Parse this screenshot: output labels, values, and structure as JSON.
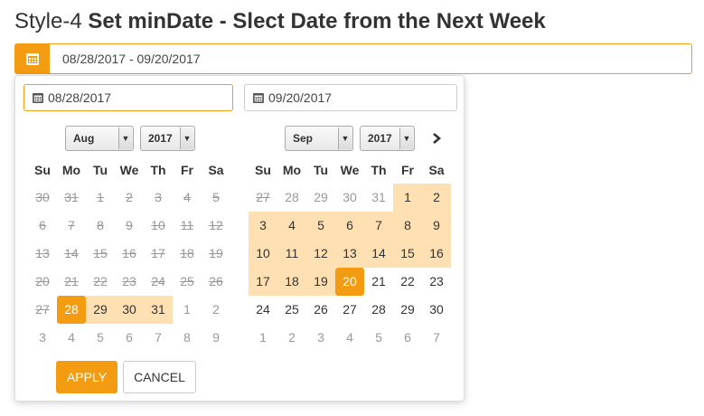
{
  "heading": {
    "prefix": "Style-4 ",
    "bold": "Set minDate - Slect Date from the Next Week"
  },
  "range_field": {
    "icon": "calendar-icon",
    "value": "08/28/2017 - 09/20/2017"
  },
  "start_input": {
    "value": "08/28/2017",
    "icon": "calendar-icon"
  },
  "end_input": {
    "value": "09/20/2017",
    "icon": "calendar-icon"
  },
  "left_calendar": {
    "month": "Aug",
    "year": "2017",
    "weekdays": [
      "Su",
      "Mo",
      "Tu",
      "We",
      "Th",
      "Fr",
      "Sa"
    ],
    "days": [
      {
        "d": "30",
        "s": "dis"
      },
      {
        "d": "31",
        "s": "dis"
      },
      {
        "d": "1",
        "s": "dis"
      },
      {
        "d": "2",
        "s": "dis"
      },
      {
        "d": "3",
        "s": "dis"
      },
      {
        "d": "4",
        "s": "dis"
      },
      {
        "d": "5",
        "s": "dis"
      },
      {
        "d": "6",
        "s": "dis"
      },
      {
        "d": "7",
        "s": "dis"
      },
      {
        "d": "8",
        "s": "dis"
      },
      {
        "d": "9",
        "s": "dis"
      },
      {
        "d": "10",
        "s": "dis"
      },
      {
        "d": "11",
        "s": "dis"
      },
      {
        "d": "12",
        "s": "dis"
      },
      {
        "d": "13",
        "s": "dis"
      },
      {
        "d": "14",
        "s": "dis"
      },
      {
        "d": "15",
        "s": "dis"
      },
      {
        "d": "16",
        "s": "dis"
      },
      {
        "d": "17",
        "s": "dis"
      },
      {
        "d": "18",
        "s": "dis"
      },
      {
        "d": "19",
        "s": "dis"
      },
      {
        "d": "20",
        "s": "dis"
      },
      {
        "d": "21",
        "s": "dis"
      },
      {
        "d": "22",
        "s": "dis"
      },
      {
        "d": "23",
        "s": "dis"
      },
      {
        "d": "24",
        "s": "dis"
      },
      {
        "d": "25",
        "s": "dis"
      },
      {
        "d": "26",
        "s": "dis"
      },
      {
        "d": "27",
        "s": "dis"
      },
      {
        "d": "28",
        "s": "sel-day"
      },
      {
        "d": "29",
        "s": "inr"
      },
      {
        "d": "30",
        "s": "inr"
      },
      {
        "d": "31",
        "s": "inr"
      },
      {
        "d": "1",
        "s": "off"
      },
      {
        "d": "2",
        "s": "off"
      },
      {
        "d": "3",
        "s": "off"
      },
      {
        "d": "4",
        "s": "off"
      },
      {
        "d": "5",
        "s": "off"
      },
      {
        "d": "6",
        "s": "off"
      },
      {
        "d": "7",
        "s": "off"
      },
      {
        "d": "8",
        "s": "off"
      },
      {
        "d": "9",
        "s": "off"
      }
    ]
  },
  "right_calendar": {
    "month": "Sep",
    "year": "2017",
    "weekdays": [
      "Su",
      "Mo",
      "Tu",
      "We",
      "Th",
      "Fr",
      "Sa"
    ],
    "days": [
      {
        "d": "27",
        "s": "dis"
      },
      {
        "d": "28",
        "s": "off"
      },
      {
        "d": "29",
        "s": "off"
      },
      {
        "d": "30",
        "s": "off"
      },
      {
        "d": "31",
        "s": "off"
      },
      {
        "d": "1",
        "s": "inr"
      },
      {
        "d": "2",
        "s": "inr"
      },
      {
        "d": "3",
        "s": "inr"
      },
      {
        "d": "4",
        "s": "inr"
      },
      {
        "d": "5",
        "s": "inr"
      },
      {
        "d": "6",
        "s": "inr"
      },
      {
        "d": "7",
        "s": "inr"
      },
      {
        "d": "8",
        "s": "inr"
      },
      {
        "d": "9",
        "s": "inr"
      },
      {
        "d": "10",
        "s": "inr"
      },
      {
        "d": "11",
        "s": "inr"
      },
      {
        "d": "12",
        "s": "inr"
      },
      {
        "d": "13",
        "s": "inr"
      },
      {
        "d": "14",
        "s": "inr"
      },
      {
        "d": "15",
        "s": "inr"
      },
      {
        "d": "16",
        "s": "inr"
      },
      {
        "d": "17",
        "s": "inr"
      },
      {
        "d": "18",
        "s": "inr"
      },
      {
        "d": "19",
        "s": "inr"
      },
      {
        "d": "20",
        "s": "sel-day"
      },
      {
        "d": "21",
        "s": ""
      },
      {
        "d": "22",
        "s": ""
      },
      {
        "d": "23",
        "s": ""
      },
      {
        "d": "24",
        "s": ""
      },
      {
        "d": "25",
        "s": ""
      },
      {
        "d": "26",
        "s": ""
      },
      {
        "d": "27",
        "s": ""
      },
      {
        "d": "28",
        "s": ""
      },
      {
        "d": "29",
        "s": ""
      },
      {
        "d": "30",
        "s": ""
      },
      {
        "d": "1",
        "s": "off"
      },
      {
        "d": "2",
        "s": "off"
      },
      {
        "d": "3",
        "s": "off"
      },
      {
        "d": "4",
        "s": "off"
      },
      {
        "d": "5",
        "s": "off"
      },
      {
        "d": "6",
        "s": "off"
      },
      {
        "d": "7",
        "s": "off"
      }
    ]
  },
  "next_icon": "chevron-right-icon",
  "dropdown_arrow": "▼",
  "buttons": {
    "apply": "APPLY",
    "cancel": "CANCEL"
  },
  "colors": {
    "accent": "#f39c12",
    "in_range": "#ffe0b2"
  }
}
